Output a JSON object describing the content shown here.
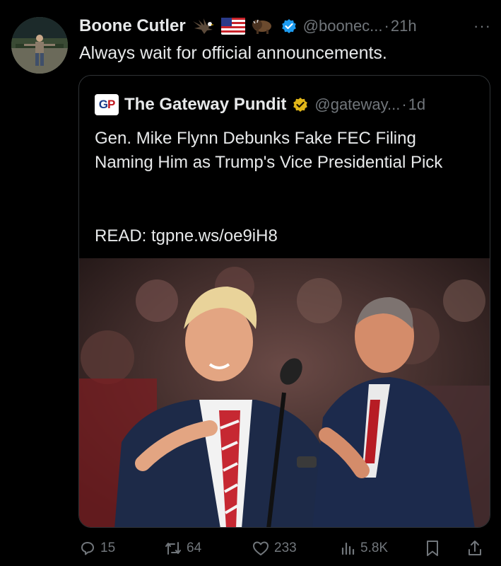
{
  "author": {
    "display_name": "Boone Cutler",
    "handle": "@boonec...",
    "separator": "·",
    "time": "21h",
    "more": "···"
  },
  "tweet": {
    "text": "Always wait for official announcements."
  },
  "quote": {
    "logo_g": "G",
    "logo_p": "P",
    "display_name": "The Gateway Pundit",
    "handle": "@gateway...",
    "separator": "·",
    "time": "1d",
    "text": "Gen. Mike Flynn Debunks Fake FEC Filing Naming Him as Trump's Vice Presidential Pick",
    "link_line": "READ: tgpne.ws/oe9iH8"
  },
  "actions": {
    "replies": "15",
    "reposts": "64",
    "likes": "233",
    "views": "5.8K"
  },
  "colors": {
    "background": "#000000",
    "text": "#e7e9ea",
    "muted": "#71767b",
    "border": "#2f3336",
    "verified_blue": "#1d9bf0",
    "verified_gold": "#e2b719"
  },
  "icons": [
    "eagle-emoji",
    "us-flag-emoji",
    "bison-emoji",
    "verified-badge-icon",
    "gold-verified-badge-icon",
    "reply-icon",
    "repost-icon",
    "like-icon",
    "views-icon",
    "bookmark-icon",
    "share-icon"
  ]
}
